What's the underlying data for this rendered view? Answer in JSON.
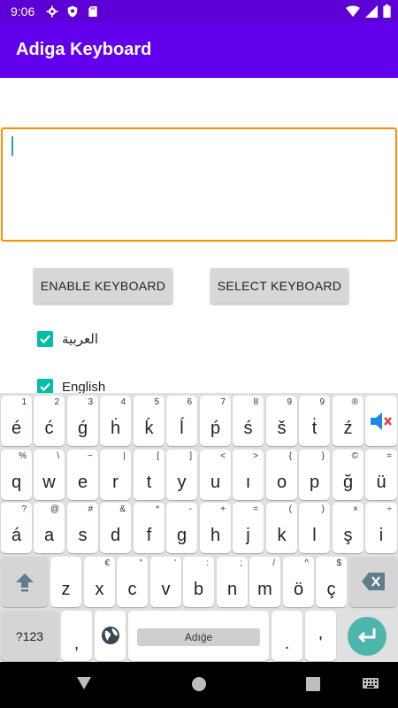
{
  "status_bar": {
    "time": "9:06",
    "icons": [
      "gear-icon",
      "shield-icon",
      "sd-card-icon",
      "wifi-icon",
      "signal-icon",
      "battery-icon"
    ]
  },
  "app_bar": {
    "title": "Adiga Keyboard"
  },
  "text_field": {
    "value": ""
  },
  "buttons": {
    "enable": "ENABLE KEYBOARD",
    "select": "SELECT KEYBOARD"
  },
  "languages": [
    {
      "label": "العربية",
      "checked": true
    },
    {
      "label": "English",
      "checked": true
    }
  ],
  "keyboard": {
    "rows": [
      [
        {
          "main": "é",
          "hint": "1"
        },
        {
          "main": "ć",
          "hint": "2"
        },
        {
          "main": "ǵ",
          "hint": "3"
        },
        {
          "main": "ḣ",
          "hint": "4"
        },
        {
          "main": "ḱ",
          "hint": "5"
        },
        {
          "main": "ĺ",
          "hint": "6"
        },
        {
          "main": "ṕ",
          "hint": "7"
        },
        {
          "main": "ś",
          "hint": "8"
        },
        {
          "main": "š",
          "hint": "9"
        },
        {
          "main": "ṫ",
          "hint": "9"
        },
        {
          "main": "ź",
          "hint": "®"
        }
      ],
      [
        {
          "main": "q",
          "hint": "%"
        },
        {
          "main": "w",
          "hint": "\\"
        },
        {
          "main": "e",
          "hint": "~"
        },
        {
          "main": "r",
          "hint": "|"
        },
        {
          "main": "t",
          "hint": "["
        },
        {
          "main": "y",
          "hint": "]"
        },
        {
          "main": "u",
          "hint": "<"
        },
        {
          "main": "ı",
          "hint": ">"
        },
        {
          "main": "o",
          "hint": "{"
        },
        {
          "main": "p",
          "hint": "}"
        },
        {
          "main": "ğ",
          "hint": "©"
        },
        {
          "main": "ü",
          "hint": "="
        }
      ],
      [
        {
          "main": "á",
          "hint": "?"
        },
        {
          "main": "a",
          "hint": "@"
        },
        {
          "main": "s",
          "hint": "#"
        },
        {
          "main": "d",
          "hint": "&"
        },
        {
          "main": "f",
          "hint": "*"
        },
        {
          "main": "g",
          "hint": "-"
        },
        {
          "main": "h",
          "hint": "+"
        },
        {
          "main": "j",
          "hint": "="
        },
        {
          "main": "k",
          "hint": "("
        },
        {
          "main": "l",
          "hint": ")"
        },
        {
          "main": "ş",
          "hint": "×"
        },
        {
          "main": "i",
          "hint": "÷"
        }
      ],
      [
        {
          "main": "z",
          "hint": ""
        },
        {
          "main": "x",
          "hint": "€"
        },
        {
          "main": "c",
          "hint": "\""
        },
        {
          "main": "v",
          "hint": "'"
        },
        {
          "main": "b",
          "hint": ":"
        },
        {
          "main": "n",
          "hint": ";"
        },
        {
          "main": "m",
          "hint": "/"
        },
        {
          "main": "ö",
          "hint": "^"
        },
        {
          "main": "ç",
          "hint": "$"
        }
      ]
    ],
    "numbers_key": "?123",
    "comma_key": ",",
    "space_label": "Adıǵe",
    "period_key": ".",
    "apostrophe_key": "'"
  },
  "colors": {
    "status_bar": "#5c00d6",
    "app_bar": "#6200ee",
    "field_border": "#ff8f00",
    "checkbox": "#00bfa5",
    "enter_key": "#4db6ac",
    "mute": "#1e88e5"
  }
}
